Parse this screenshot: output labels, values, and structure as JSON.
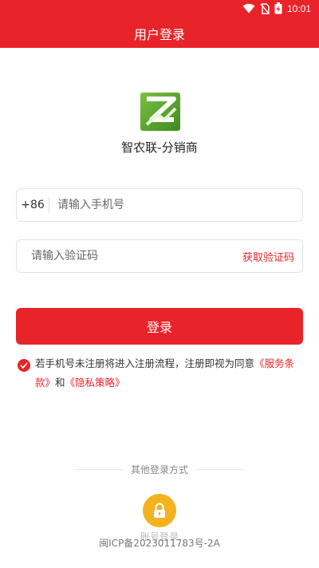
{
  "status_bar": {
    "time": "10:01",
    "battery_level": "charging"
  },
  "header": {
    "title": "用户登录"
  },
  "brand": {
    "name": "智农联-分销商",
    "logo_color": "#5aa32c"
  },
  "phone": {
    "prefix": "+86",
    "placeholder": "请输入手机号",
    "value": ""
  },
  "code": {
    "placeholder": "请输入验证码",
    "value": "",
    "get_code_label": "获取验证码"
  },
  "login": {
    "button_label": "登录"
  },
  "agreement": {
    "checked": true,
    "text_before": "若手机号未注册将进入注册流程，注册即视为同意",
    "service_link": "《服务条款》",
    "connector": "和",
    "privacy_link": "《隐私策略》"
  },
  "other_login": {
    "label": "其他登录方式",
    "account_label": "账号登录",
    "icon": "lock-icon"
  },
  "footer": {
    "icp": "闽ICP备2023011783号-2A"
  },
  "colors": {
    "primary": "#e8242a",
    "accent": "#f5b21f"
  }
}
